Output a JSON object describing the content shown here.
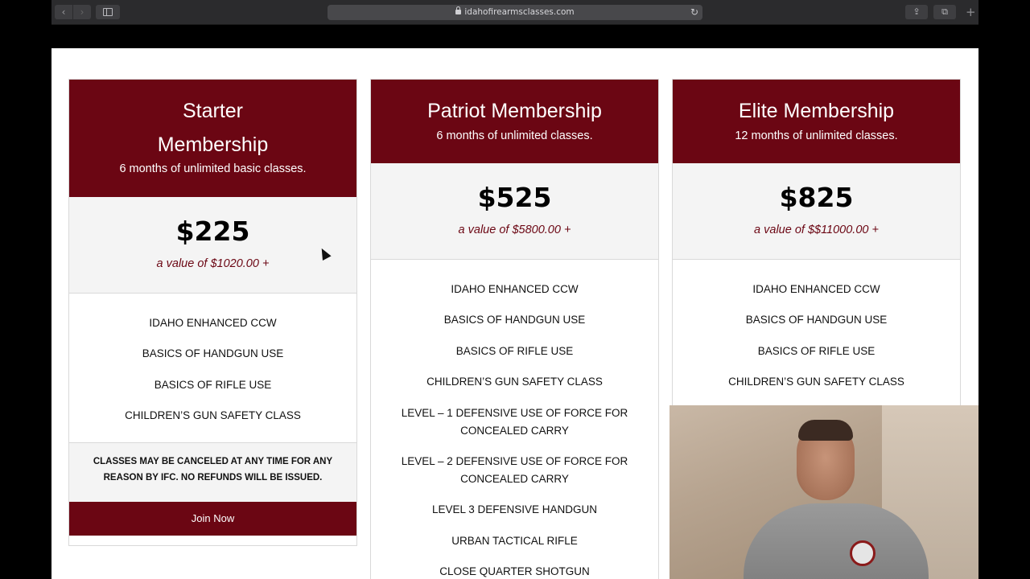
{
  "browser": {
    "url": "idahofirearmsclasses.com",
    "back_icon": "‹",
    "forward_icon": "›",
    "reload_icon": "↻",
    "share_icon": "⇪",
    "tabs_icon": "⧉",
    "plus_icon": "+"
  },
  "colors": {
    "brand": "#6b0613",
    "panel": "#f4f4f4"
  },
  "plans": [
    {
      "title": "Starter Membership",
      "subtitle": "6 months of unlimited basic classes.",
      "price": "$225",
      "value_note": "a value of $1020.00 +",
      "features": [
        "IDAHO ENHANCED CCW",
        "BASICS OF HANDGUN USE",
        "BASICS OF RIFLE USE",
        "CHILDREN’S GUN SAFETY CLASS"
      ],
      "notice": "CLASSES MAY BE CANCELED AT ANY TIME FOR ANY REASON BY IFC. NO REFUNDS WILL BE ISSUED.",
      "cta": "Join Now"
    },
    {
      "title": "Patriot Membership",
      "subtitle": "6 months of unlimited classes.",
      "price": "$525",
      "value_note": "a value of $5800.00 +",
      "features": [
        "IDAHO ENHANCED CCW",
        "BASICS OF HANDGUN USE",
        "BASICS OF RIFLE USE",
        "CHILDREN’S GUN SAFETY CLASS",
        "LEVEL – 1 DEFENSIVE USE OF FORCE FOR CONCEALED CARRY",
        "LEVEL – 2 DEFENSIVE USE OF FORCE FOR CONCEALED CARRY",
        "LEVEL 3 DEFENSIVE HANDGUN",
        "URBAN TACTICAL RIFLE",
        "CLOSE QUARTER SHOTGUN"
      ]
    },
    {
      "title": "Elite Membership",
      "subtitle": "12 months of unlimited classes.",
      "price": "$825",
      "value_note": "a value of $$11000.00 +",
      "features": [
        "IDAHO ENHANCED CCW",
        "BASICS OF HANDGUN USE",
        "BASICS OF RIFLE USE",
        "CHILDREN’S GUN SAFETY CLASS"
      ]
    }
  ]
}
